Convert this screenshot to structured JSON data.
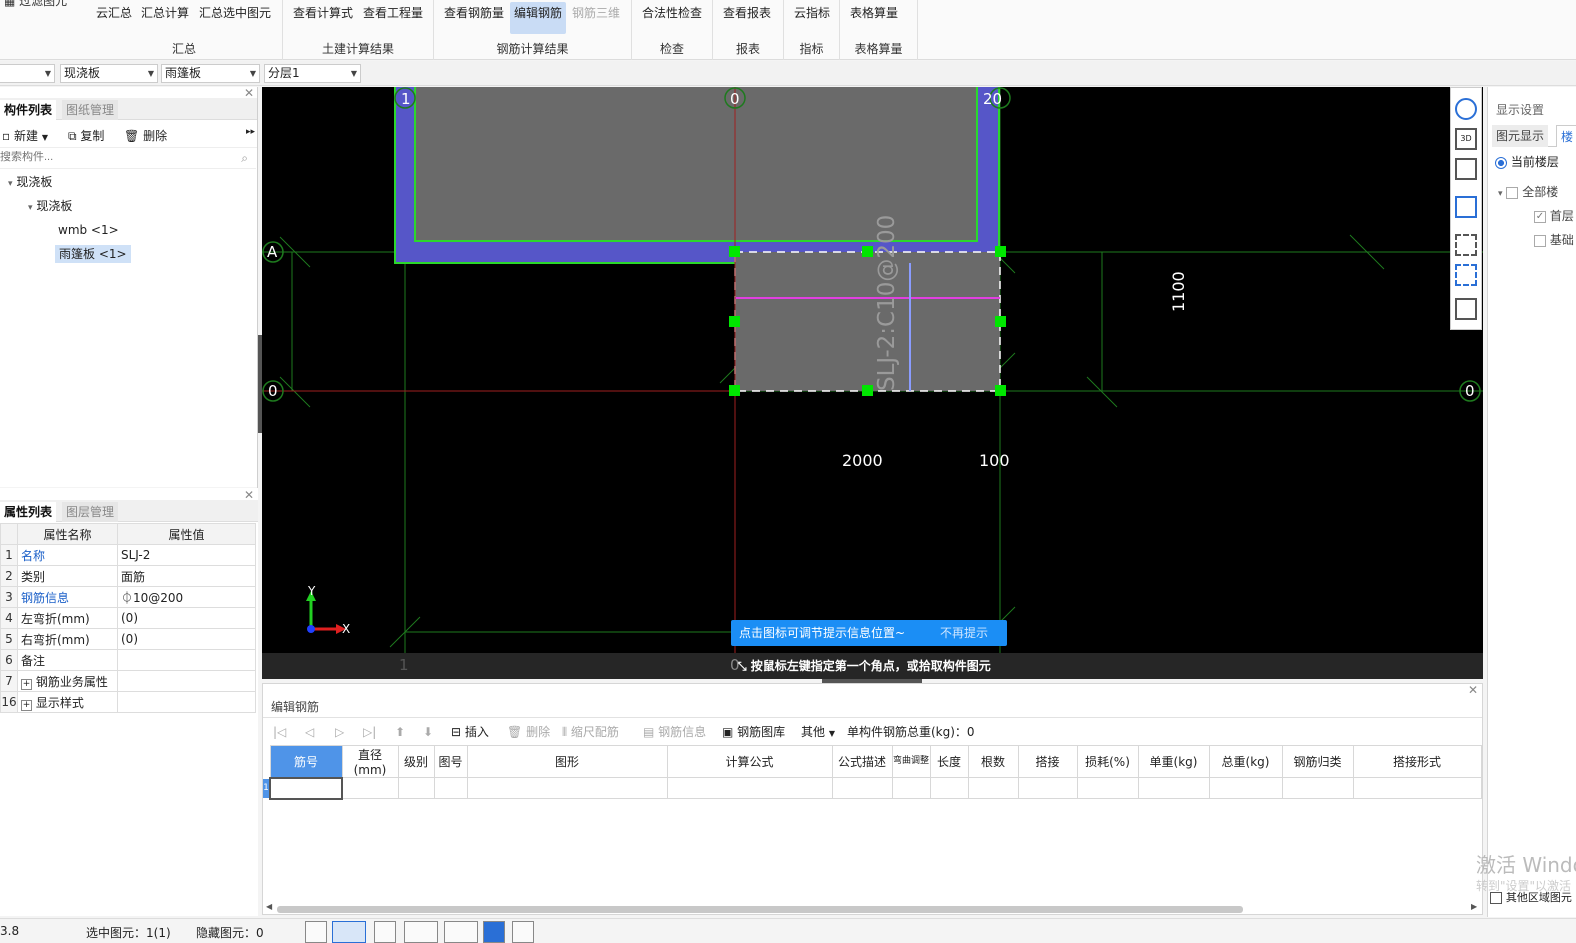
{
  "ribbon": {
    "truncated_left": "过滤图元",
    "groups": [
      {
        "label": "汇总",
        "buttons": [
          "云汇总",
          "汇总计算",
          "汇总选中图元"
        ]
      },
      {
        "label": "土建计算结果",
        "buttons": [
          "查看计算式",
          "查看工程量"
        ]
      },
      {
        "label": "钢筋计算结果",
        "buttons": [
          "查看钢筋量",
          "编辑钢筋",
          "钢筋三维"
        ]
      },
      {
        "label": "检查",
        "buttons": [
          "合法性检查"
        ]
      },
      {
        "label": "报表",
        "buttons": [
          "查看报表"
        ]
      },
      {
        "label": "指标",
        "buttons": [
          "云指标"
        ]
      },
      {
        "label": "表格算量",
        "buttons": [
          "表格算量"
        ]
      }
    ]
  },
  "toolbar2": {
    "combo1": "",
    "combo2": "现浇板",
    "combo3": "雨篷板",
    "combo4": "分层1"
  },
  "component_panel": {
    "tabs": [
      "构件列表",
      "图纸管理"
    ],
    "actions": {
      "new": "新建",
      "copy": "复制",
      "delete": "删除"
    },
    "search_placeholder": "搜索构件...",
    "tree": [
      "现浇板",
      "现浇板",
      "wmb <1>",
      "雨篷板 <1>"
    ]
  },
  "property_panel": {
    "tabs": [
      "属性列表",
      "图层管理"
    ],
    "headers": [
      "属性名称",
      "属性值"
    ],
    "rows": [
      {
        "num": "1",
        "name": "名称",
        "value": "SLJ-2"
      },
      {
        "num": "2",
        "name": "类别",
        "value": "面筋"
      },
      {
        "num": "3",
        "name": "钢筋信息",
        "value": "⏀10@200"
      },
      {
        "num": "4",
        "name": "左弯折(mm)",
        "value": "(0)"
      },
      {
        "num": "5",
        "name": "右弯折(mm)",
        "value": "(0)"
      },
      {
        "num": "6",
        "name": "备注",
        "value": ""
      },
      {
        "num": "7",
        "name": "钢筋业务属性",
        "value": ""
      },
      {
        "num": "16",
        "name": "显示样式",
        "value": ""
      }
    ]
  },
  "canvas": {
    "axis_labels": {
      "top1": "1",
      "top2": "0",
      "top3": "20",
      "left_a": "A",
      "left_0": "0",
      "right_0": "0",
      "bot1": "1",
      "bot2": "0"
    },
    "dims": {
      "d2000": "2000",
      "d100": "100",
      "d1100": "1100"
    },
    "rebar_label": "SLJ-2:C10@200",
    "tip": "点击图标可调节提示信息位置~",
    "tip_dismiss": "不再提示",
    "command": "按鼠标左键指定第一个角点，或拾取构件图元",
    "axis_x": "X",
    "axis_y": "Y"
  },
  "rebar_editor": {
    "title": "编辑钢筋",
    "tools": [
      "插入",
      "删除",
      "缩尺配筋",
      "钢筋信息",
      "钢筋图库",
      "其他"
    ],
    "total_label": "单构件钢筋总重(kg)：0",
    "columns": [
      "筋号",
      "直径(mm)",
      "级别",
      "图号",
      "图形",
      "计算公式",
      "公式描述",
      "弯曲调整",
      "长度",
      "根数",
      "搭接",
      "损耗(%)",
      "单重(kg)",
      "总重(kg)",
      "钢筋归类",
      "搭接形式"
    ],
    "row1": "1"
  },
  "right_panel": {
    "title": "显示设置",
    "tabs": [
      "图元显示",
      "楼"
    ],
    "radio": "当前楼层",
    "items": [
      "全部楼",
      "首层",
      "基础"
    ],
    "other": "其他区域图元"
  },
  "status": {
    "left": "3.8",
    "selected": "选中图元：1(1)",
    "hidden": "隐藏图元：0"
  },
  "watermark": {
    "line1": "激活 Windows",
    "line2": "转到\"设置\"以激活"
  }
}
